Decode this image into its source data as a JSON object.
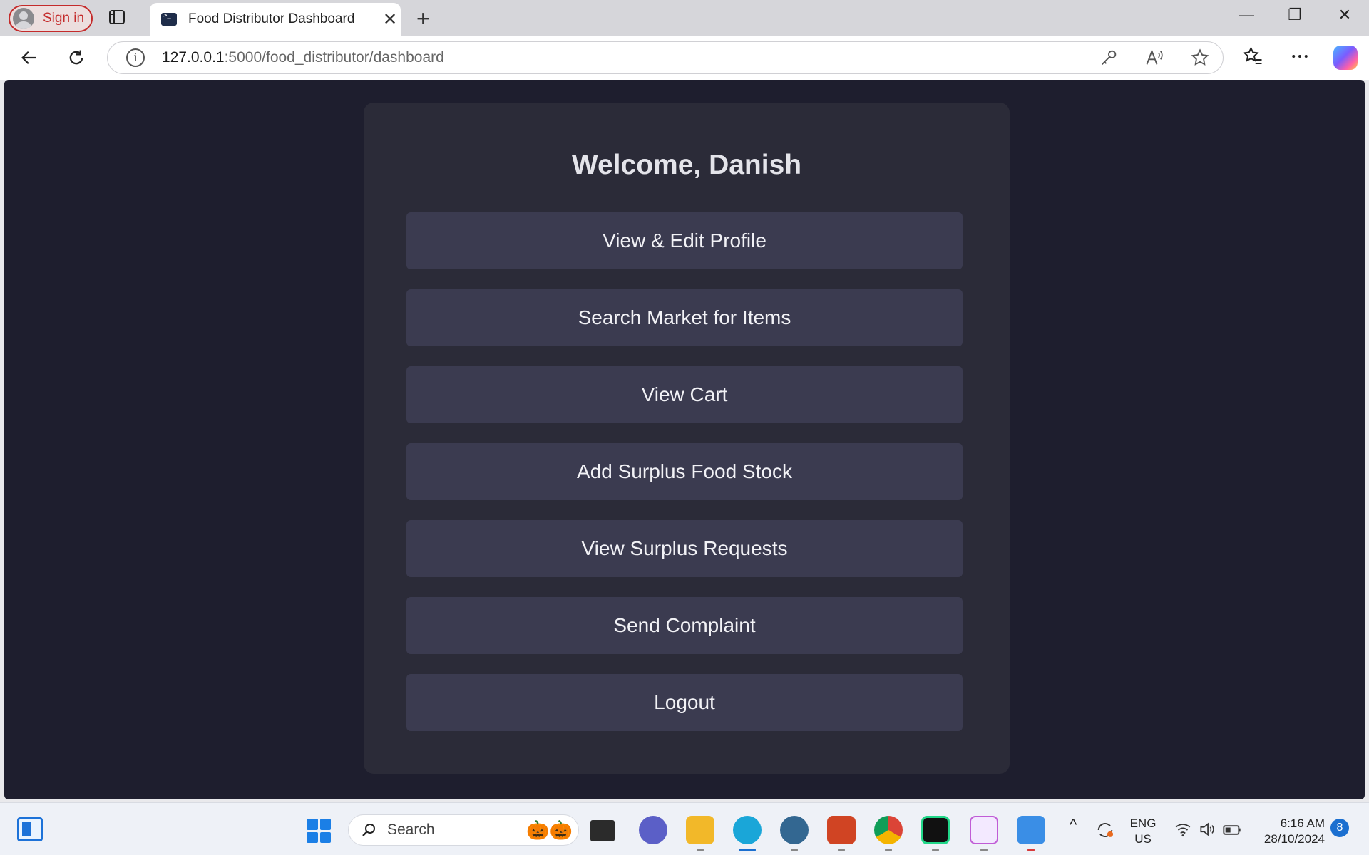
{
  "browser": {
    "signin_label": "Sign in",
    "tab_title": "Food Distributor Dashboard",
    "url_host": "127.0.0.1",
    "url_path": ":5000/food_distributor/dashboard"
  },
  "page": {
    "welcome": "Welcome, Danish",
    "buttons": [
      "View & Edit Profile",
      "Search Market for Items",
      "View Cart",
      "Add Surplus Food Stock",
      "View Surplus Requests",
      "Send Complaint",
      "Logout"
    ]
  },
  "taskbar": {
    "search_label": "Search",
    "lang_line1": "ENG",
    "lang_line2": "US",
    "time": "6:16 AM",
    "date": "28/10/2024",
    "notification_count": "8"
  },
  "colors": {
    "page_bg": "#1e1e2e",
    "card_bg": "#2b2b38",
    "button_bg": "#3b3b50",
    "text": "#f2f2f6",
    "signin_accent": "#c42b2b"
  }
}
